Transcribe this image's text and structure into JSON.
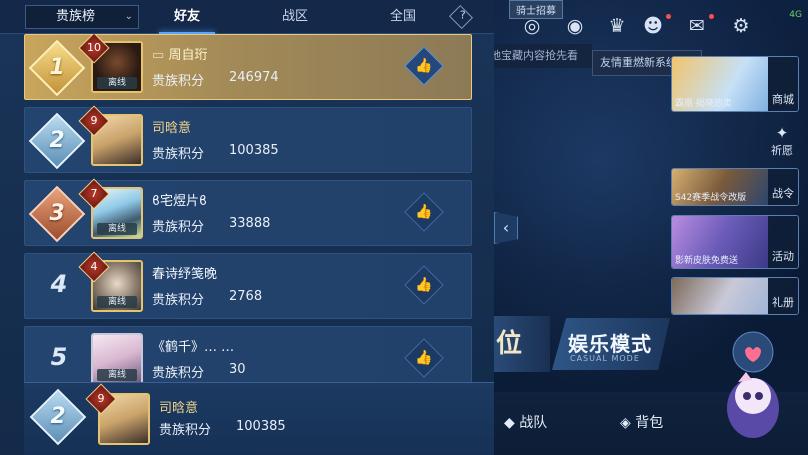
{
  "topbar": {
    "live_tag": "骑士招募",
    "signal": "4G",
    "notice_left": "地宝藏内容抢先看",
    "notice_right": "友情重燃新系统上线",
    "icons": [
      "target-icon",
      "eye-icon",
      "trophy-icon",
      "friends-icon",
      "mail-icon",
      "gear-icon"
    ]
  },
  "sidebar": {
    "shop": {
      "caption": "霸凰·揭晓热卖",
      "label": "商城"
    },
    "wish": {
      "label": "祈愿"
    },
    "battle_pass": {
      "caption": "S42赛季战令改版",
      "label": "战令"
    },
    "event": {
      "caption": "影新皮肤免费送",
      "label": "活动"
    },
    "gift": {
      "label": "礼册"
    }
  },
  "modes": {
    "left_partial": "位",
    "casual_title": "娱乐模式",
    "casual_sub": "CASUAL MODE"
  },
  "bottom_bar": {
    "team": "战队",
    "bag": "背包"
  },
  "panel": {
    "dropdown": "贵族榜",
    "tabs": [
      "好友",
      "战区",
      "全国"
    ],
    "active_tab": 0,
    "help": "?"
  },
  "ranking": [
    {
      "rank": "1",
      "level": "10",
      "name": "周自珩",
      "status": "离线",
      "points_label": "贵族积分",
      "points": "246974",
      "liked": true
    },
    {
      "rank": "2",
      "level": "9",
      "name": "司晗意",
      "status": "",
      "points_label": "贵族积分",
      "points": "100385",
      "liked": false
    },
    {
      "rank": "3",
      "level": "7",
      "name": "ϐ宅煜片ϐ",
      "status": "离线",
      "points_label": "贵族积分",
      "points": "33888",
      "liked": true
    },
    {
      "rank": "4",
      "level": "4",
      "name": "春诗纾笺晚",
      "status": "离线",
      "points_label": "贵族积分",
      "points": "2768",
      "liked": true
    },
    {
      "rank": "5",
      "level": "",
      "name": "《鹤千》… …",
      "status": "离线",
      "points_label": "贵族积分",
      "points": "30",
      "liked": true
    }
  ],
  "me": {
    "rank": "2",
    "level": "9",
    "name": "司晗意",
    "points_label": "贵族积分",
    "points": "100385"
  },
  "colors": {
    "gold_row": "#c9a55c",
    "row": "#22426c",
    "accent": "#5aa6ff",
    "name_gold": "#f3d58a"
  }
}
